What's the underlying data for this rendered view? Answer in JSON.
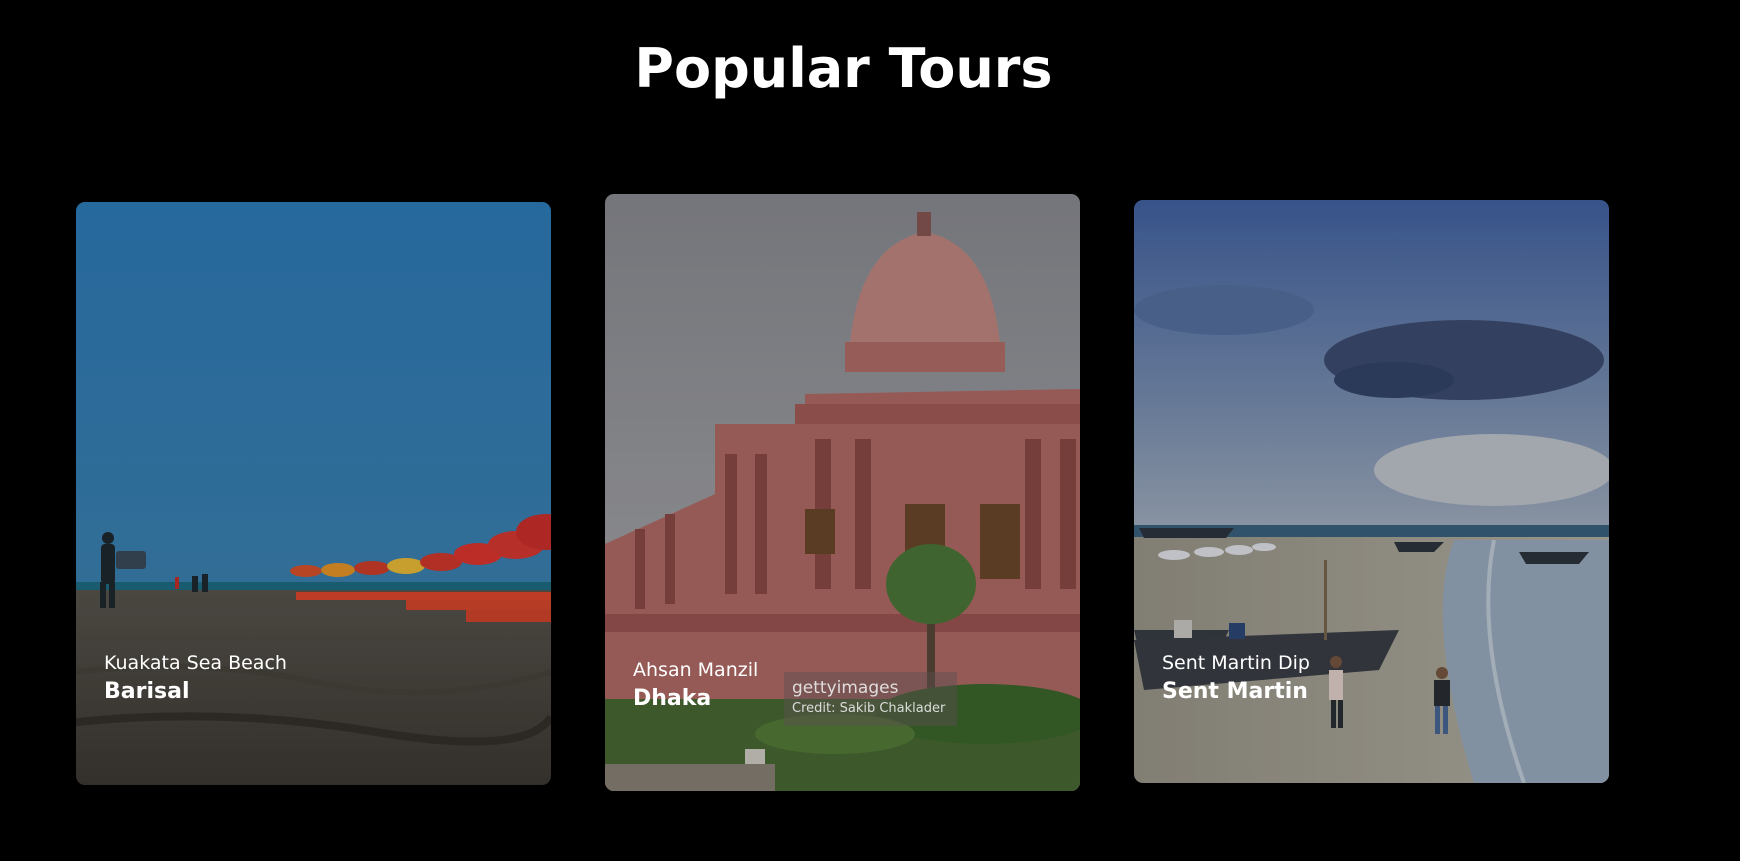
{
  "page": {
    "heading": "Popular Tours"
  },
  "colors": {
    "background": "#000000",
    "text": "#ffffff"
  },
  "tours": [
    {
      "subtitle": "Kuakata Sea Beach",
      "title": "Barisal",
      "image": "beach-with-umbrellas-photo"
    },
    {
      "subtitle": "Ahsan Manzil",
      "title": "Dhaka",
      "image": "pink-palace-photo",
      "watermark": {
        "brand": "gettyimages",
        "credit": "Credit: Sakib Chaklader"
      }
    },
    {
      "subtitle": "Sent Martin Dip",
      "title": "Sent Martin",
      "image": "beach-with-boats-photo"
    }
  ]
}
